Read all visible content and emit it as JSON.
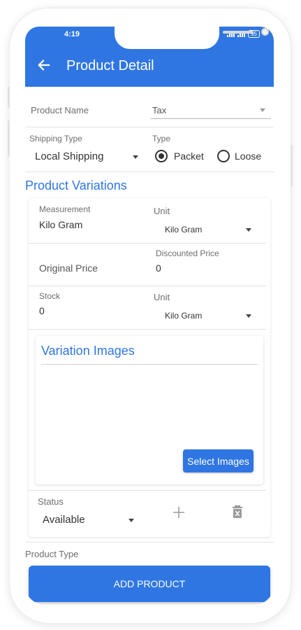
{
  "status_bar": {
    "time": "4:19",
    "battery": "95"
  },
  "app_bar": {
    "title": "Product Detail",
    "back_icon": "arrow-left-icon"
  },
  "product_name": {
    "label": "Product Name",
    "value": "Tax"
  },
  "shipping_type": {
    "label": "Shipping Type",
    "value": "Local Shipping"
  },
  "type": {
    "label": "Type",
    "options": [
      "Packet",
      "Loose"
    ],
    "selected": "Packet"
  },
  "variations": {
    "title": "Product Variations",
    "measurement": {
      "label": "Measurement",
      "value": "Kilo Gram"
    },
    "unit": {
      "label": "Unit",
      "value": "Kilo Gram"
    },
    "original_price": {
      "label": "Original Price"
    },
    "discounted_price": {
      "label": "Discounted Price",
      "value": "0"
    },
    "stock": {
      "label": "Stock",
      "value": "0"
    },
    "stock_unit": {
      "label": "Unit",
      "value": "Kilo Gram"
    },
    "images": {
      "title": "Variation Images",
      "select_label": "Select Images"
    },
    "status": {
      "label": "Status",
      "value": "Available"
    },
    "add_icon": "plus-icon",
    "delete_icon": "trash-icon"
  },
  "product_type": {
    "label": "Product Type"
  },
  "add_product_label": "ADD PRODUCT",
  "colors": {
    "primary": "#2f76e3",
    "background": "#ffffff"
  }
}
